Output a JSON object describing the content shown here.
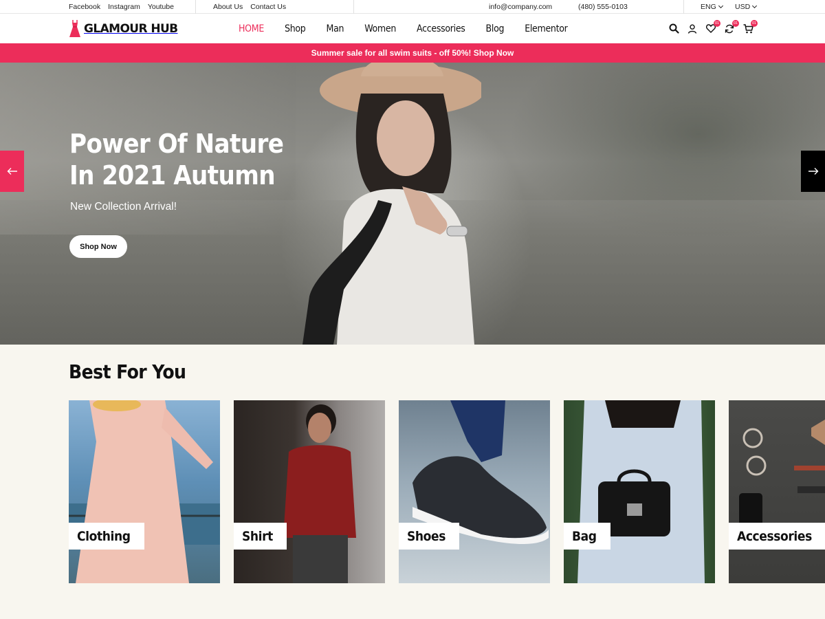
{
  "topbar": {
    "social": [
      "Facebook",
      "Instagram",
      "Youtube"
    ],
    "links": [
      "About Us",
      "Contact Us"
    ],
    "email": "info@company.com",
    "phone": "(480) 555-0103",
    "language": "ENG",
    "currency": "USD"
  },
  "header": {
    "logo_text": "GLAMOUR HUB",
    "nav": [
      "HOME",
      "Shop",
      "Man",
      "Women",
      "Accessories",
      "Blog",
      "Elementor"
    ],
    "active_nav": "HOME",
    "wishlist_count": "01",
    "compare_count": "01",
    "cart_count": "01"
  },
  "promo": {
    "text": "Summer sale for all swim suits - off 50%! Shop Now"
  },
  "hero": {
    "title_line1": "Power Of Nature",
    "title_line2": "In 2021 Autumn",
    "subtitle": "New Collection Arrival!",
    "button_label": "Shop Now"
  },
  "best": {
    "title": "Best For You",
    "categories": [
      {
        "label": "Clothing"
      },
      {
        "label": "Shirt"
      },
      {
        "label": "Shoes"
      },
      {
        "label": "Bag"
      },
      {
        "label": "Accessories"
      }
    ]
  },
  "colors": {
    "accent": "#ec2d5a",
    "page_background": "#f8f6ef"
  }
}
